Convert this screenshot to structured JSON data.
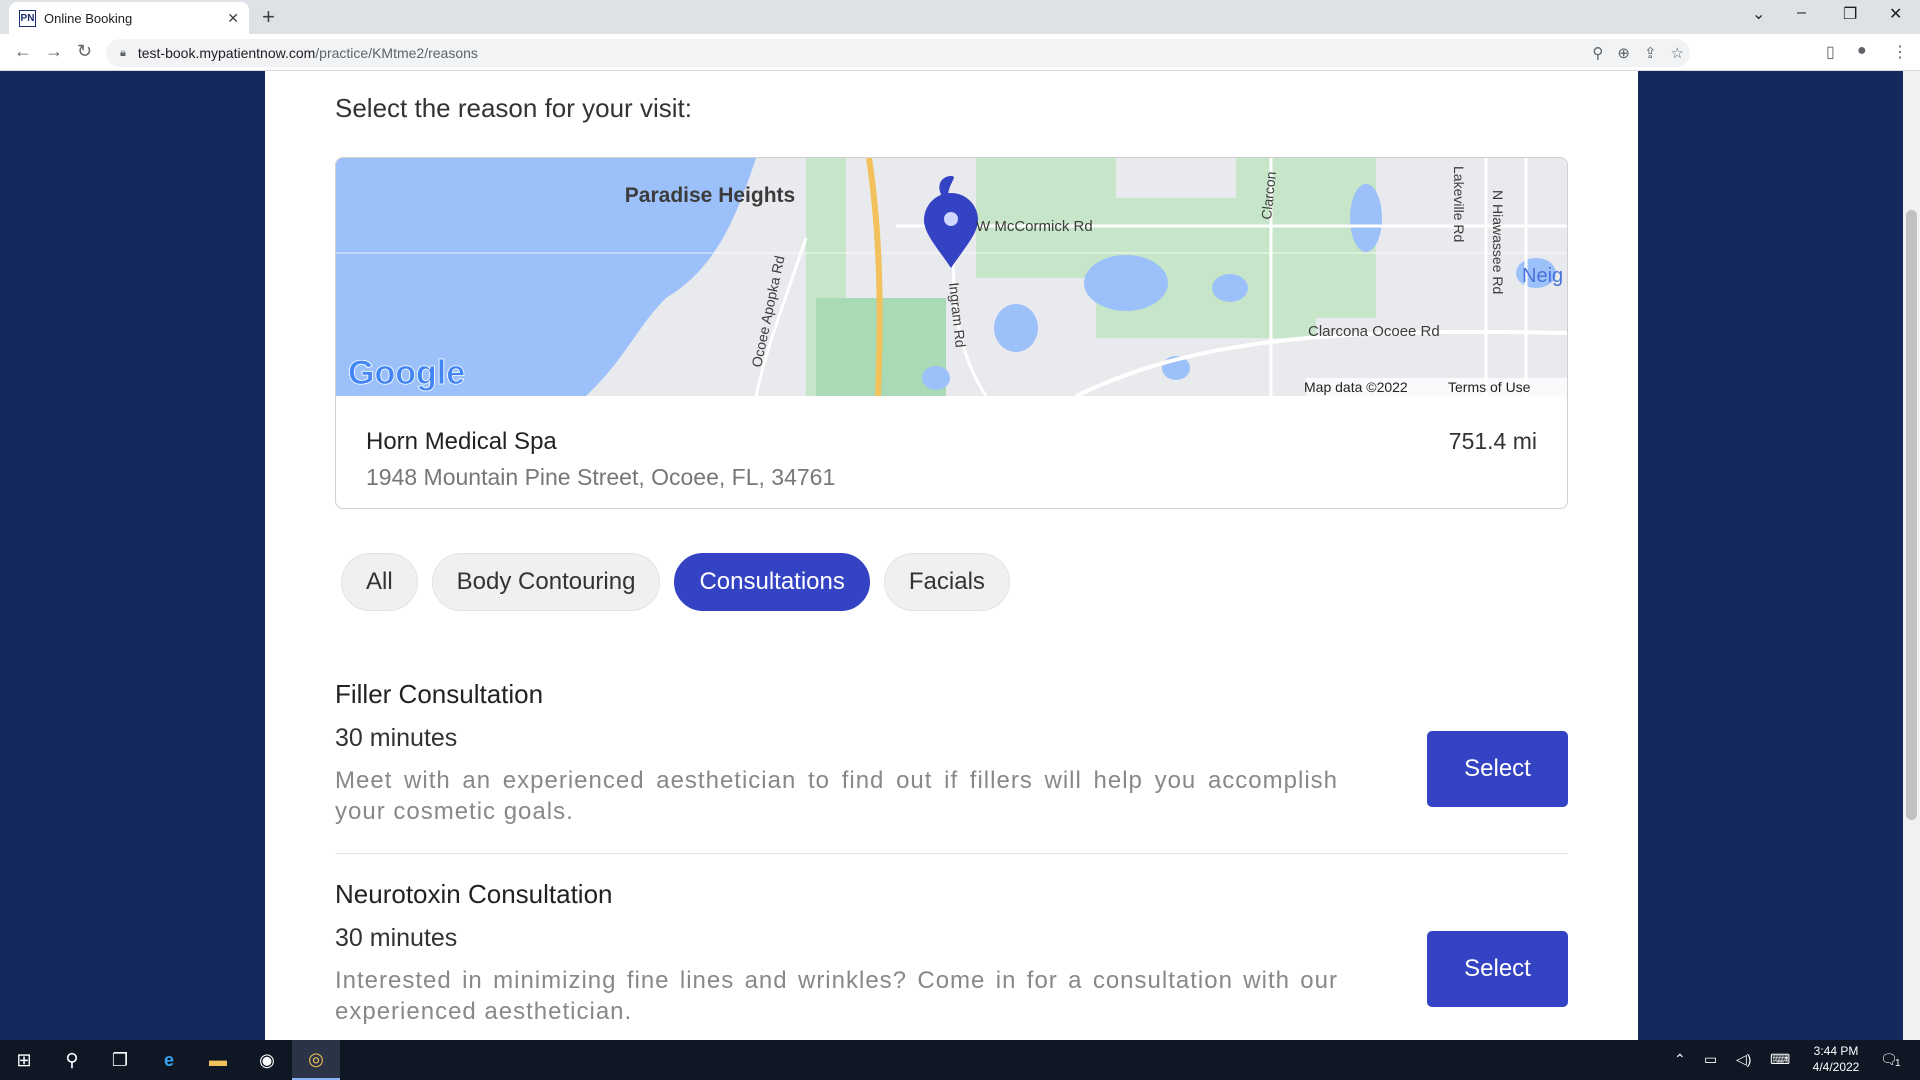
{
  "browser": {
    "tab_title": "Online Booking",
    "favicon_text": "PN",
    "url_domain": "test-book.mypatientnow.com",
    "url_path": "/practice/KMtme2/reasons"
  },
  "page": {
    "heading": "Select the reason for your visit:"
  },
  "location": {
    "name": "Horn Medical Spa",
    "address": "1948 Mountain Pine Street, Ocoee, FL, 34761",
    "distance": "751.4 mi",
    "map": {
      "labels": [
        "Paradise Heights",
        "W McCormick Rd",
        "Ocoee Apopka Rd",
        "Ingram Rd",
        "Clarcon",
        "Lakeville Rd",
        "N Hiawassee Rd",
        "Neig",
        "Clarcona Ocoee Rd"
      ],
      "logo": "Google",
      "map_data": "Map data ©2022",
      "terms": "Terms of Use"
    }
  },
  "filters": [
    {
      "label": "All",
      "active": false
    },
    {
      "label": "Body Contouring",
      "active": false
    },
    {
      "label": "Consultations",
      "active": true
    },
    {
      "label": "Facials",
      "active": false
    }
  ],
  "reasons": [
    {
      "title": "Filler Consultation",
      "duration": "30 minutes",
      "description": "Meet with an experienced aesthetician to find out if fillers will help you accomplish your cosmetic goals.",
      "button": "Select"
    },
    {
      "title": "Neurotoxin Consultation",
      "duration": "30 minutes",
      "description": "Interested in minimizing fine lines and wrinkles? Come in for a consultation with our experienced aesthetician.",
      "button": "Select"
    }
  ],
  "taskbar": {
    "time": "3:44 PM",
    "date": "4/4/2022",
    "notification_count": "1"
  },
  "colors": {
    "accent": "#3443c4",
    "background": "#13285b"
  }
}
